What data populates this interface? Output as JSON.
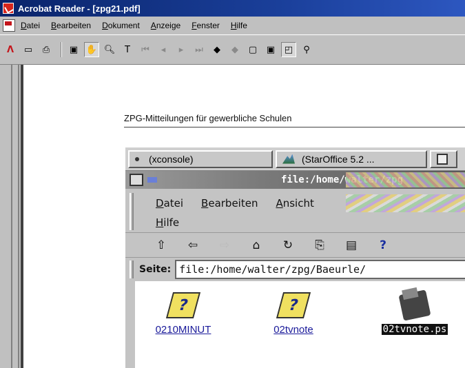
{
  "window": {
    "title": "Acrobat Reader - [zpg21.pdf]"
  },
  "menu": [
    "Datei",
    "Bearbeiten",
    "Dokument",
    "Anzeige",
    "Fenster",
    "Hilfe"
  ],
  "document": {
    "heading": "ZPG-Mitteilungen für gewerbliche Schulen"
  },
  "embedded": {
    "tasks": [
      "(xconsole)",
      "(StarOffice 5.2 ..."
    ],
    "window_title": "file:/home/walter/zpg",
    "menu_row1": [
      "Datei",
      "Bearbeiten",
      "Ansicht"
    ],
    "menu_row2": "Hilfe",
    "url_label": "Seite:",
    "url_value": "file:/home/walter/zpg/Baeurle/",
    "files": [
      {
        "name": "0210MINUT",
        "icon": "question-doc-icon"
      },
      {
        "name": "02tvnote",
        "icon": "question-doc-icon"
      },
      {
        "name": "02tvnote.ps",
        "icon": "printer-icon"
      }
    ]
  }
}
